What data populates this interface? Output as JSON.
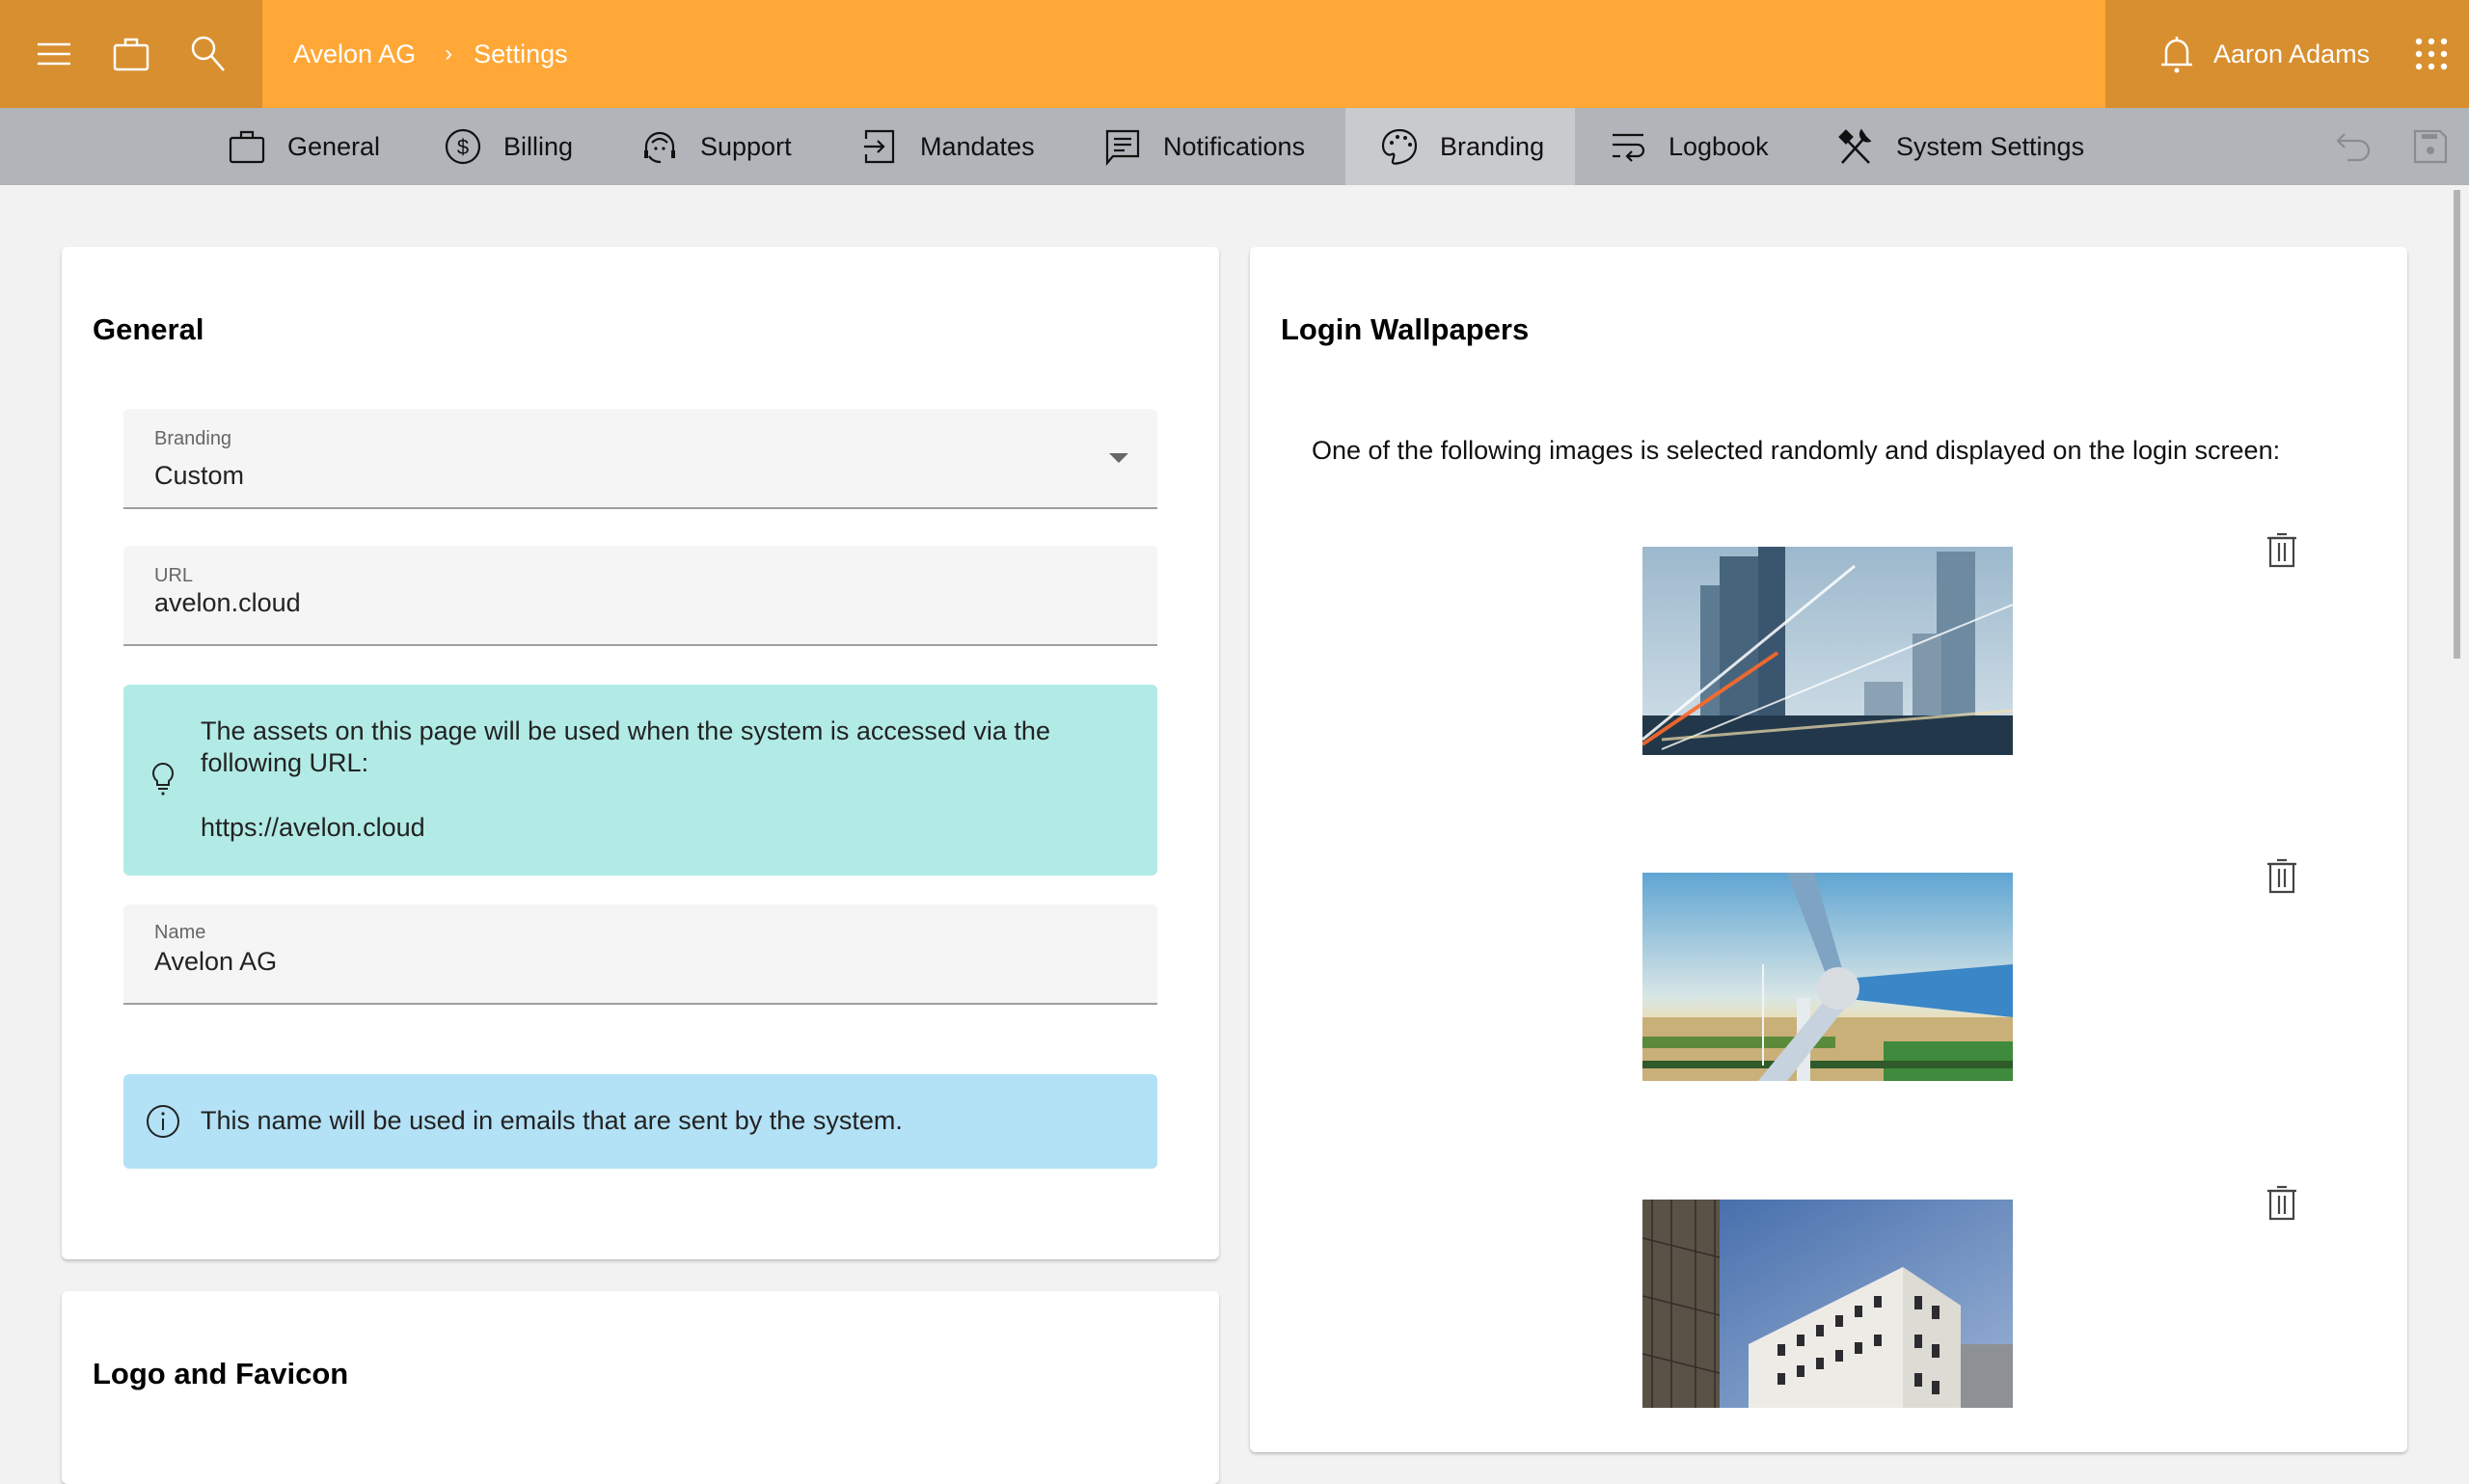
{
  "header": {
    "breadcrumb": [
      "Avelon AG",
      "Settings"
    ],
    "breadcrumb_separator": "›",
    "user_name": "Aaron Adams",
    "icons": [
      "menu-icon",
      "briefcase-icon",
      "search-icon",
      "bell-icon",
      "apps-grid-icon"
    ],
    "colors": {
      "primary": "#FFA837",
      "primary_dark": "#D88F30"
    }
  },
  "tabs": [
    {
      "label": "General",
      "icon": "briefcase-icon",
      "active": false
    },
    {
      "label": "Billing",
      "icon": "dollar-circle-icon",
      "active": false
    },
    {
      "label": "Support",
      "icon": "headset-icon",
      "active": false
    },
    {
      "label": "Mandates",
      "icon": "sign-in-icon",
      "active": false
    },
    {
      "label": "Notifications",
      "icon": "message-icon",
      "active": false
    },
    {
      "label": "Branding",
      "icon": "palette-icon",
      "active": true
    },
    {
      "label": "Logbook",
      "icon": "logbook-icon",
      "active": false
    },
    {
      "label": "System Settings",
      "icon": "tools-icon",
      "active": false
    }
  ],
  "toolbar": {
    "undo_icon": "undo-icon",
    "save_icon": "save-icon"
  },
  "general_card": {
    "title": "General",
    "branding_field": {
      "label": "Branding",
      "value": "Custom"
    },
    "url_field": {
      "label": "URL",
      "value": "avelon.cloud"
    },
    "url_hint": {
      "line1": "The assets on this page will be used when the system is accessed via the following URL:",
      "line2": "https://avelon.cloud",
      "color": "#B2EBE5"
    },
    "name_field": {
      "label": "Name",
      "value": "Avelon AG"
    },
    "name_hint": {
      "text": "This name will be used in emails that are sent by the system.",
      "color": "#B3E1F5"
    }
  },
  "logo_card": {
    "title": "Logo and Favicon"
  },
  "wallpapers_card": {
    "title": "Login Wallpapers",
    "intro": "One of the following images is selected randomly and displayed on the login screen:",
    "images": [
      {
        "subject": "city skyscrapers with light trails"
      },
      {
        "subject": "wind turbine over farmland"
      },
      {
        "subject": "modern white office building"
      }
    ]
  }
}
